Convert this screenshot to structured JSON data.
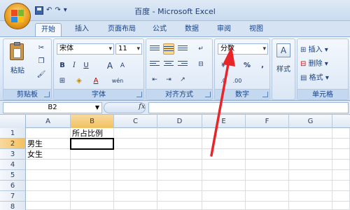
{
  "window": {
    "title": "百度 - Microsoft Excel"
  },
  "qat": {
    "undo": "↶",
    "redo": "↷",
    "menu": "▾"
  },
  "tabs": [
    {
      "label": "开始"
    },
    {
      "label": "插入"
    },
    {
      "label": "页面布局"
    },
    {
      "label": "公式"
    },
    {
      "label": "数据"
    },
    {
      "label": "审阅"
    },
    {
      "label": "视图"
    }
  ],
  "ribbon": {
    "clipboard": {
      "paste_label": "粘贴",
      "group_label": "剪贴板"
    },
    "font": {
      "font_name": "宋体",
      "font_size": "11",
      "grow": "A",
      "shrink": "A",
      "bold": "B",
      "italic": "I",
      "underline": "U",
      "phonetic": "wén",
      "group_label": "字体"
    },
    "alignment": {
      "group_label": "对齐方式"
    },
    "number": {
      "format": "分数",
      "percent": "%",
      "comma": ",",
      "group_label": "数字"
    },
    "styles": {
      "label": "样式"
    },
    "cells": {
      "insert": "插入",
      "delete": "删除",
      "format": "格式",
      "group_label": "单元格"
    }
  },
  "formula_bar": {
    "cell_ref": "B2",
    "fx": "fx",
    "value": ""
  },
  "grid": {
    "columns": [
      "A",
      "B",
      "C",
      "D",
      "E",
      "F",
      "G"
    ],
    "rows": [
      "1",
      "2",
      "3",
      "4",
      "5",
      "6",
      "7",
      "8"
    ],
    "cells": {
      "B1": "所占比例",
      "A2": "男生",
      "A3": "女生"
    },
    "active_cell": "B2"
  },
  "colors": {
    "annotation": "#e8262a",
    "ribbon": "#dbe7f5",
    "selected": "#fdd889"
  }
}
